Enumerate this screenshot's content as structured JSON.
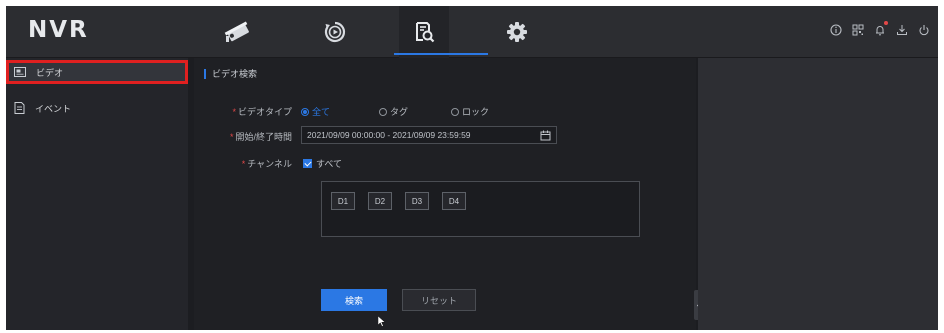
{
  "header": {
    "logo": "NVR",
    "nav_tabs": [
      {
        "name": "live-view",
        "icon": "camera-icon",
        "active": false
      },
      {
        "name": "playback",
        "icon": "playback-icon",
        "active": false
      },
      {
        "name": "search",
        "icon": "file-search-icon",
        "active": true
      },
      {
        "name": "settings",
        "icon": "gear-icon",
        "active": false
      }
    ],
    "right_icons": [
      "info-icon",
      "qr-code-icon",
      "bell-icon",
      "download-icon",
      "power-icon"
    ]
  },
  "sidebar": {
    "items": [
      {
        "label": "ビデオ",
        "icon": "video-file-icon",
        "selected": true
      },
      {
        "label": "イベント",
        "icon": "document-icon",
        "selected": false
      }
    ]
  },
  "main": {
    "section_title": "ビデオ検索",
    "video_type": {
      "label": "ビデオタイプ",
      "options": [
        "全て",
        "タグ",
        "ロック"
      ],
      "selected": "全て"
    },
    "time": {
      "label": "開始/終了時間",
      "value": "2021/09/09 00:00:00 - 2021/09/09 23:59:59"
    },
    "channel": {
      "label": "チャンネル",
      "select_all_label": "すべて",
      "select_all_checked": true,
      "channels": [
        "D1",
        "D2",
        "D3",
        "D4"
      ]
    },
    "buttons": {
      "search": "検索",
      "reset": "リセット"
    }
  },
  "colors": {
    "accent": "#2b78e4",
    "highlight_border": "#e02020",
    "background": "#1c1d21"
  }
}
